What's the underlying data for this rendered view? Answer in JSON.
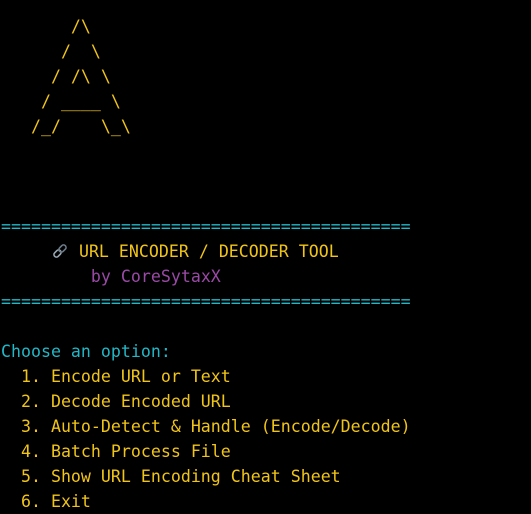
{
  "banner": {
    "ascii_art": [
      "       /\\",
      "      /  \\",
      "     / /\\ \\",
      "    / ____ \\",
      "   /_/    \\_\\"
    ]
  },
  "header": {
    "rule_top": "=========================================",
    "title": "URL ENCODER / DECODER TOOL",
    "title_icon": "link-icon",
    "byline": "by CoreSytaxX",
    "rule_bottom": "========================================="
  },
  "menu": {
    "prompt": "Choose an option:",
    "options": [
      "  1. Encode URL or Text",
      "  2. Decode Encoded URL",
      "  3. Auto-Detect & Handle (Encode/Decode)",
      "  4. Batch Process File",
      "  5. Show URL Encoding Cheat Sheet",
      "  6. Exit"
    ]
  },
  "colors": {
    "background": "#000000",
    "ascii": "#f0c419",
    "rule": "#21b8c8",
    "byline": "#9a4aa6",
    "prompt": "#21b8c8",
    "option": "#f0c419"
  }
}
